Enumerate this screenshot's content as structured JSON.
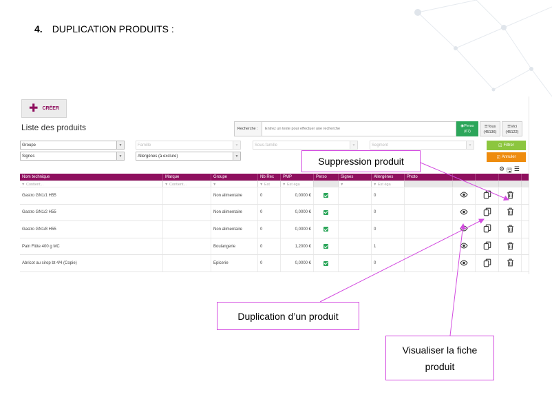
{
  "document": {
    "heading_number": "4.",
    "heading_text": "DUPLICATION PRODUITS :"
  },
  "app": {
    "create_label": "CRÉER",
    "page_title": "Liste des produits",
    "search": {
      "label": "Recherche :",
      "placeholder": "Entrez un texte pour effectuer une recherche"
    },
    "scope_buttons": [
      {
        "label": "Perso",
        "count": "(67)"
      },
      {
        "label": "Tous",
        "count": "(45136)"
      },
      {
        "label": "Vici",
        "count": "(45122)"
      }
    ],
    "filters": {
      "groupe": "Groupe",
      "famille": "Famille",
      "sous_famille": "Sous-famille",
      "segment": "Segment",
      "signes": "Signes",
      "allergenes": "Allergènes (à exclure)",
      "filter_btn": "Filtrer",
      "cancel_btn": "Annuler"
    },
    "table": {
      "headers": [
        "Nom technique",
        "Marque",
        "Groupe",
        "Nb Rec",
        "PMP",
        "Perso",
        "Signes",
        "Allergènes",
        "Photo"
      ],
      "filter_placeholders": {
        "nom": "Contient...",
        "marque": "Contient...",
        "nbrec": "Est",
        "pmp": "Est éga",
        "allerg": "Est éga"
      },
      "rows": [
        {
          "nom": "Gastro GN1/1 H55",
          "marque": "",
          "groupe": "Non alimentaire",
          "nbrec": "0",
          "pmp": "0,0000 €",
          "allerg": "0"
        },
        {
          "nom": "Gastro GN1/2 H55",
          "marque": "",
          "groupe": "Non alimentaire",
          "nbrec": "0",
          "pmp": "0,0000 €",
          "allerg": "0"
        },
        {
          "nom": "Gastro GN1/8 H55",
          "marque": "",
          "groupe": "Non alimentaire",
          "nbrec": "0",
          "pmp": "0,0000 €",
          "allerg": "0"
        },
        {
          "nom": "Pain Flûte 400 g MC",
          "marque": "",
          "groupe": "Boulangerie",
          "nbrec": "0",
          "pmp": "1,2000 €",
          "allerg": "1"
        },
        {
          "nom": "Abricot au sirop bt 4/4 (Copie)",
          "marque": "",
          "groupe": "Epicerie",
          "nbrec": "0",
          "pmp": "0,0000 €",
          "allerg": "0"
        }
      ]
    }
  },
  "callouts": {
    "suppression": "Suppression produit",
    "duplication": "Duplication d’un produit",
    "visualiser_1": "Visualiser la fiche",
    "visualiser_2": "produit"
  },
  "colors": {
    "primary": "#8e0f5e",
    "success": "#2ca65a",
    "filter": "#8cc63f",
    "cancel": "#ee8c0e",
    "callout_border": "#d34be0"
  }
}
